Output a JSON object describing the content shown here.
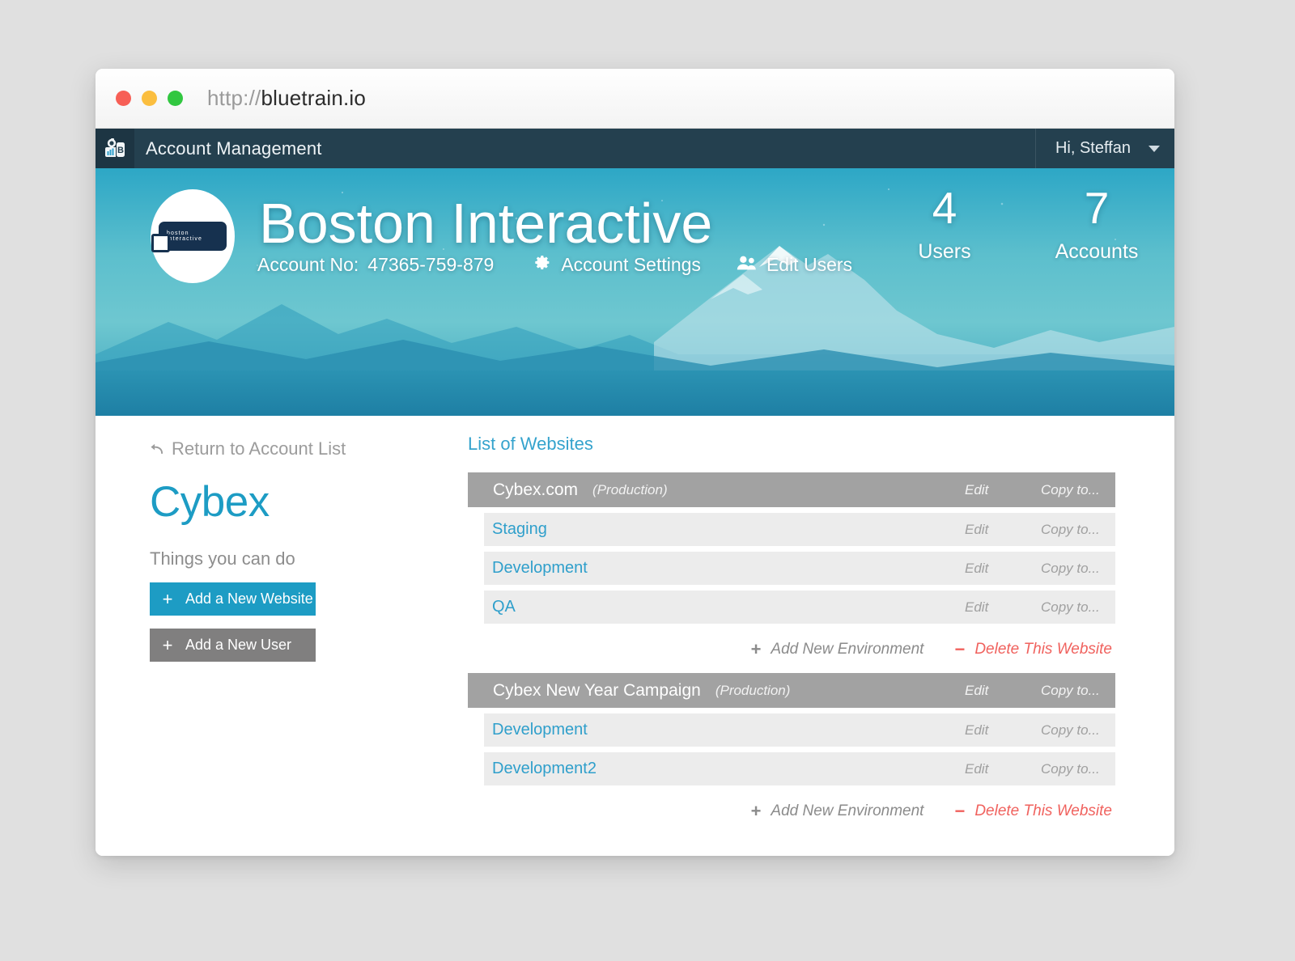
{
  "browser": {
    "url_scheme": "http://",
    "url_host": "bluetrain.io",
    "traffic_lights": [
      "close-red",
      "minimize-yellow",
      "maximize-green"
    ]
  },
  "appnav": {
    "logo_icon": "train-logo-icon",
    "title": "Account Management",
    "user_greeting": "Hi, Steffan",
    "chevron_icon": "chevron-down-icon"
  },
  "hero": {
    "logo_text": "boston interactive",
    "company": "Boston Interactive",
    "account_label": "Account No:",
    "account_number": "47365-759-879",
    "links": [
      {
        "icon": "gear-icon",
        "label": "Account Settings"
      },
      {
        "icon": "users-icon",
        "label": "Edit Users"
      }
    ],
    "stats": [
      {
        "value": "4",
        "label": "Users"
      },
      {
        "value": "7",
        "label": "Accounts"
      }
    ]
  },
  "sidebar": {
    "return_icon": "back-arrow-icon",
    "return_label": "Return to Account List",
    "account_name": "Cybex",
    "things_label": "Things you can do",
    "buttons": [
      {
        "symbol": "+",
        "label": "Add a New Website",
        "style": "primary"
      },
      {
        "symbol": "+",
        "label": "Add a New User",
        "style": "secondary"
      }
    ]
  },
  "websites": {
    "heading": "List of Websites",
    "action_edit": "Edit",
    "action_copy": "Copy to...",
    "add_env_label": "Add New Environment",
    "add_env_symbol": "+",
    "delete_label": "Delete This Website",
    "delete_symbol": "−",
    "items": [
      {
        "name": "Cybex.com",
        "env_tag": "(Production)",
        "environments": [
          {
            "name": "Staging"
          },
          {
            "name": "Development"
          },
          {
            "name": "QA"
          }
        ]
      },
      {
        "name": "Cybex New Year Campaign",
        "env_tag": "(Production)",
        "environments": [
          {
            "name": "Development"
          },
          {
            "name": "Development2"
          }
        ]
      }
    ]
  },
  "colors": {
    "brand_blue": "#1d9cc4",
    "nav_dark": "#24404f",
    "header_gray": "#a2a2a2",
    "row_gray": "#ececec",
    "danger_red": "#f0625e",
    "secondary_gray": "#807f7f"
  }
}
